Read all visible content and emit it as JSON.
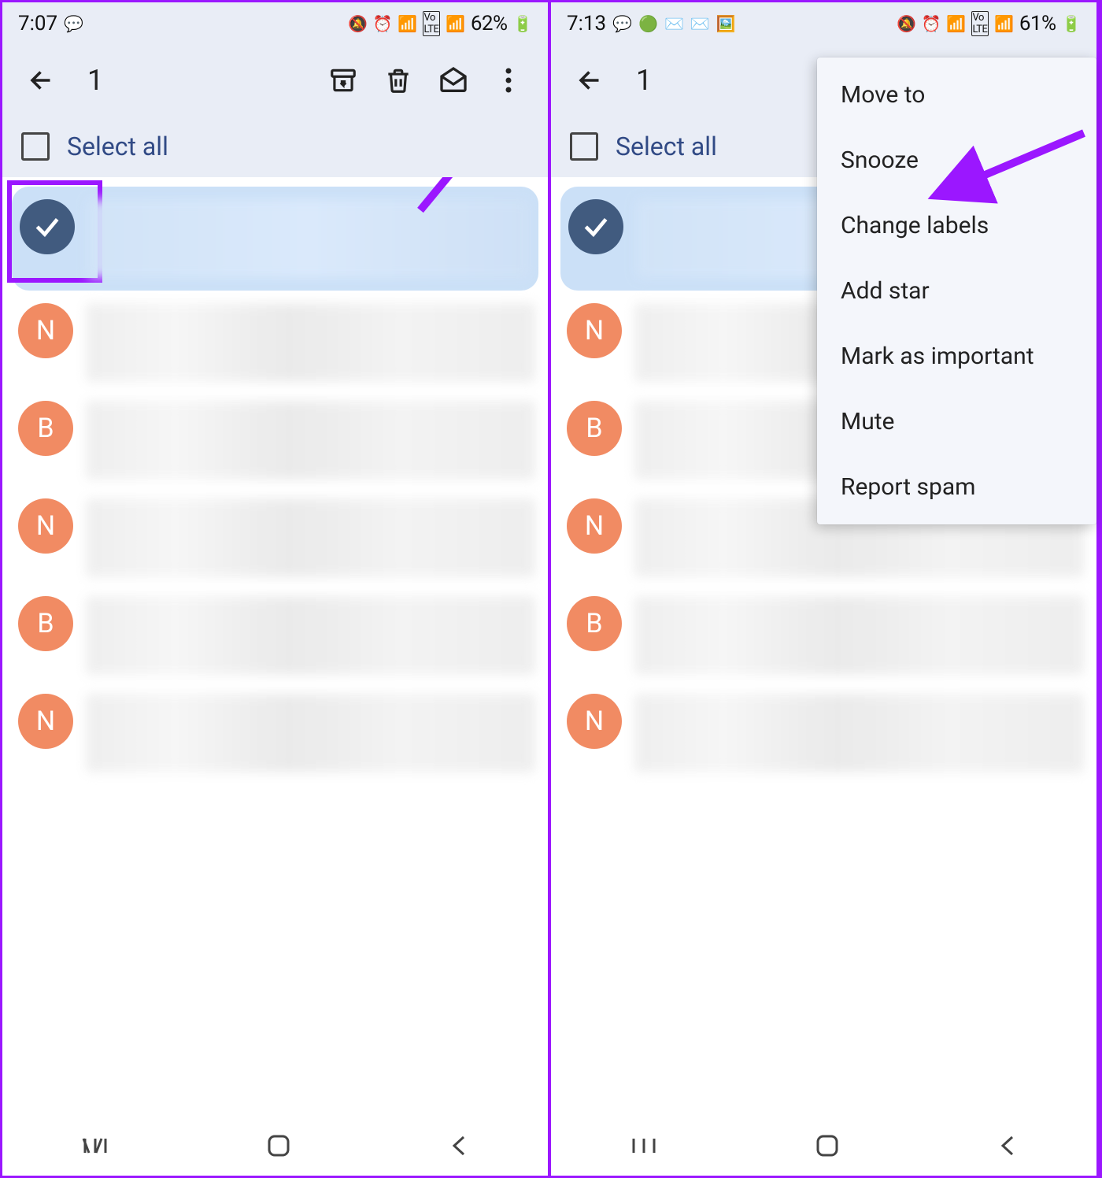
{
  "left": {
    "status": {
      "time": "7:07",
      "battery": "62%"
    },
    "appbar": {
      "selected_count": "1"
    },
    "select_all_label": "Select all",
    "rows": [
      {
        "selected": true,
        "avatar": "check",
        "letter": ""
      },
      {
        "selected": false,
        "avatar": "orange",
        "letter": "N"
      },
      {
        "selected": false,
        "avatar": "orange",
        "letter": "B"
      },
      {
        "selected": false,
        "avatar": "orange",
        "letter": "N"
      },
      {
        "selected": false,
        "avatar": "orange",
        "letter": "B"
      },
      {
        "selected": false,
        "avatar": "orange",
        "letter": "N"
      }
    ]
  },
  "right": {
    "status": {
      "time": "7:13",
      "battery": "61%"
    },
    "appbar": {
      "selected_count": "1"
    },
    "select_all_label": "Select all",
    "menu": [
      "Move to",
      "Snooze",
      "Change labels",
      "Add star",
      "Mark as important",
      "Mute",
      "Report spam"
    ],
    "rows": [
      {
        "selected": true,
        "avatar": "check",
        "letter": ""
      },
      {
        "selected": false,
        "avatar": "orange",
        "letter": "N"
      },
      {
        "selected": false,
        "avatar": "orange",
        "letter": "B"
      },
      {
        "selected": false,
        "avatar": "orange",
        "letter": "N"
      },
      {
        "selected": false,
        "avatar": "orange",
        "letter": "B"
      },
      {
        "selected": false,
        "avatar": "orange",
        "letter": "N"
      }
    ]
  }
}
